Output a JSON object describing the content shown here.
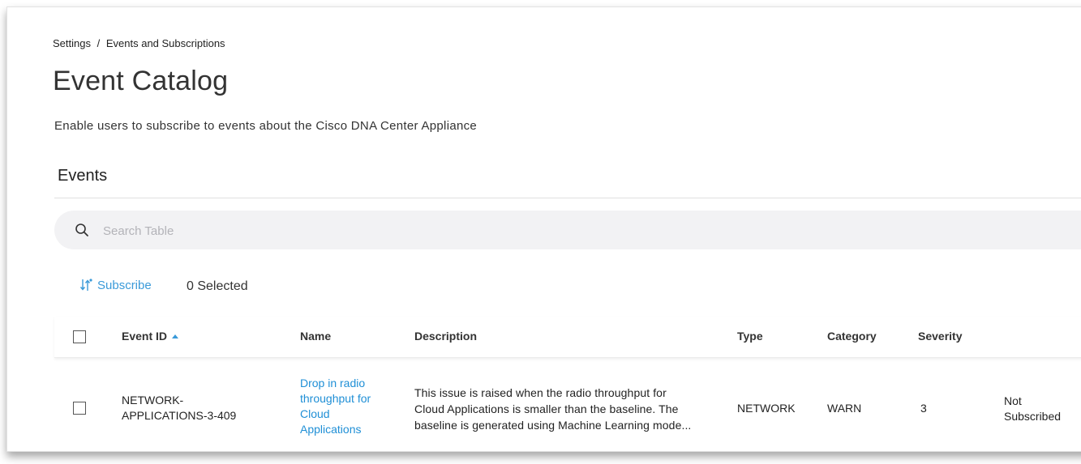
{
  "breadcrumb": {
    "parent": "Settings",
    "separator": "/",
    "current": "Events and Subscriptions"
  },
  "page": {
    "title": "Event Catalog",
    "subtitle": "Enable users to subscribe to events about the Cisco DNA Center Appliance",
    "section_title": "Events"
  },
  "search": {
    "placeholder": "Search Table",
    "value": ""
  },
  "toolbar": {
    "subscribe_label": "Subscribe",
    "selected_label": "0 Selected"
  },
  "table": {
    "columns": [
      "Event ID",
      "Name",
      "Description",
      "Type",
      "Category",
      "Severity",
      ""
    ],
    "rows": [
      {
        "event_id_line1": "NETWORK-",
        "event_id_line2": "APPLICATIONS-3-409",
        "name_lines": [
          "Drop in radio",
          "throughput for",
          "Cloud",
          "Applications"
        ],
        "description_lines": [
          "This issue is raised when the radio throughput for",
          "Cloud Applications is smaller than the baseline. The",
          "baseline is generated using Machine Learning mode..."
        ],
        "type": "NETWORK",
        "category": "WARN",
        "severity": "3",
        "status_lines": [
          "Not",
          "Subscribed"
        ]
      }
    ]
  },
  "colors": {
    "accent": "#1f8fd6",
    "search_bg": "#f2f2f4"
  }
}
